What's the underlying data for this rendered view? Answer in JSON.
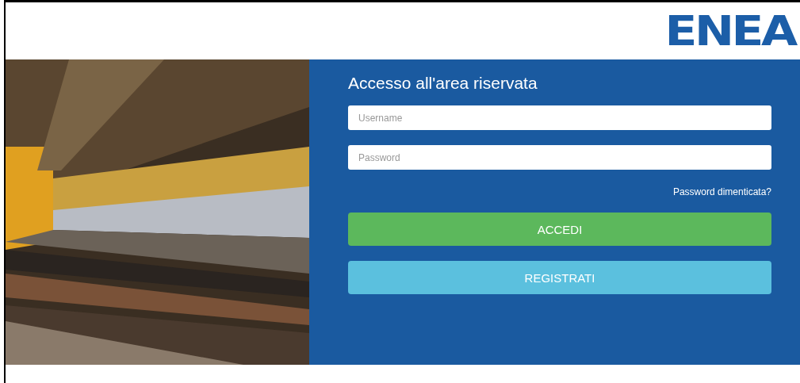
{
  "header": {
    "logo": "ENEA"
  },
  "login": {
    "title": "Accesso all'area riservata",
    "fields": [
      {
        "placeholder": "Username"
      },
      {
        "placeholder": "Password"
      }
    ],
    "forgot_link": "Password dimenticata?",
    "buttons": [
      {
        "label": "ACCEDI",
        "kind": "primary"
      },
      {
        "label": "REGISTRATI",
        "kind": "secondary"
      }
    ]
  }
}
